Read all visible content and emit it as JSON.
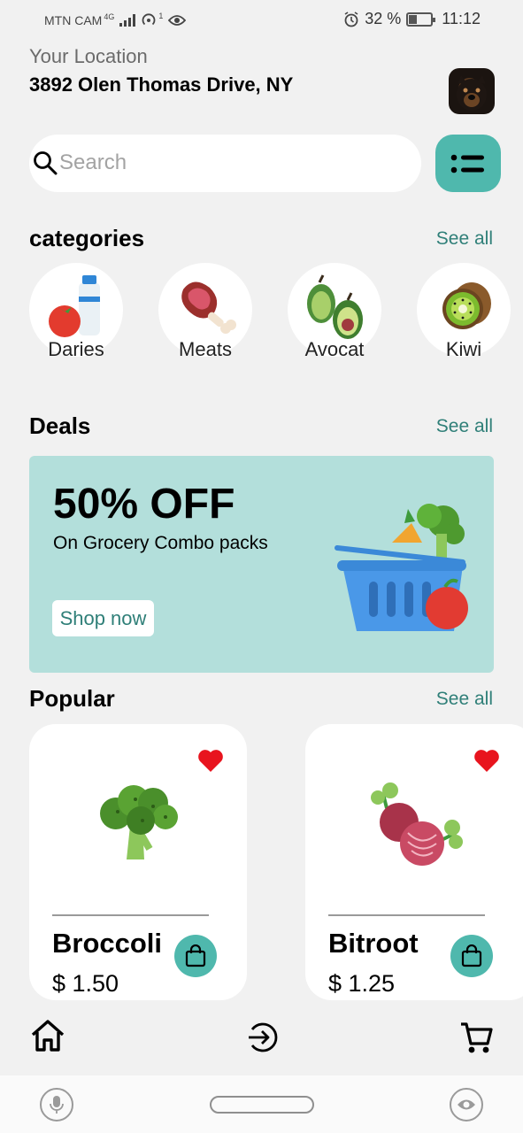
{
  "status_bar": {
    "carrier": "MTN CAM",
    "network_type": "4G",
    "notification_count": "1",
    "battery": "32 %",
    "time": "11:12"
  },
  "header": {
    "location_label": "Your Location",
    "location_value": "3892 Olen Thomas Drive, NY",
    "avatar_icon": "dog-avatar"
  },
  "search": {
    "placeholder": "Search",
    "filter_icon": "filter-list-icon"
  },
  "categories": {
    "title": "categories",
    "see_all": "See all",
    "items": [
      {
        "label": "Daries",
        "icon": "dairy-icon",
        "emoji": "🥛"
      },
      {
        "label": "Meats",
        "icon": "meat-icon",
        "emoji": "🍖"
      },
      {
        "label": "Avocat",
        "icon": "avocado-icon",
        "emoji": "🥑"
      },
      {
        "label": "Kiwi",
        "icon": "kiwi-icon",
        "emoji": "🥝"
      }
    ]
  },
  "deals": {
    "title": "Deals",
    "see_all": "See all",
    "banner": {
      "headline": "50% OFF",
      "subtitle": "On Grocery Combo packs",
      "button": "Shop now",
      "image_icon": "grocery-basket-icon"
    }
  },
  "popular": {
    "title": "Popular",
    "see_all": "See all",
    "items": [
      {
        "name": "Broccoli",
        "price": "$ 1.50",
        "icon": "broccoli-icon"
      },
      {
        "name": "Bitroot",
        "price": "$ 1.25",
        "icon": "beetroot-icon"
      }
    ]
  },
  "bottom_nav": {
    "items": [
      "home-icon",
      "login-arrow-icon",
      "cart-icon"
    ]
  },
  "system_nav": {
    "items": [
      "microphone-icon",
      "home-pill",
      "eye-icon"
    ]
  },
  "colors": {
    "accent": "#4fb8ad",
    "accent_text": "#2f7f78",
    "banner_bg": "#b3dfdb",
    "heart": "#e8141e",
    "background": "#f1f1f1"
  }
}
